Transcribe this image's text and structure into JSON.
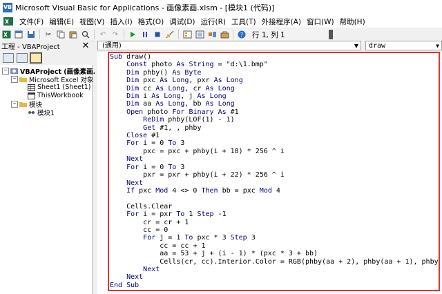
{
  "window": {
    "title": "Microsoft Visual Basic for Applications - 画像素画.xlsm - [模块1 (代码)]"
  },
  "menu": [
    "文件(F)",
    "编辑(E)",
    "视图(V)",
    "插入(I)",
    "格式(O)",
    "调试(D)",
    "运行(R)",
    "工具(T)",
    "外接程序(A)",
    "窗口(W)",
    "帮助(H)"
  ],
  "toolbar": {
    "position_text": "行 1, 列 1"
  },
  "project_panel": {
    "title": "工程 - VBAProject",
    "close": "✕",
    "tree": [
      {
        "toggle": "−",
        "label": "VBAProject (画像素画.",
        "icon": "vbaproject-icon",
        "bold": true
      },
      {
        "toggle": "−",
        "label": "Microsoft Excel 对象",
        "icon": "folder-icon"
      },
      {
        "toggle": "",
        "label": "Sheet1 (Sheet1)",
        "icon": "sheet-icon"
      },
      {
        "toggle": "",
        "label": "ThisWorkbook",
        "icon": "workbook-icon"
      },
      {
        "toggle": "−",
        "label": "模块",
        "icon": "folder-icon"
      },
      {
        "toggle": "",
        "label": "模块1",
        "icon": "module-icon"
      }
    ]
  },
  "editor": {
    "object_combo": "(通用)",
    "procedure_combo": "draw",
    "code_lines": [
      "Sub draw()",
      "    Const photo As String = \"d:\\1.bmp\"",
      "    Dim phby() As Byte",
      "    Dim pxc As Long, pxr As Long",
      "    Dim cc As Long, cr As Long",
      "    Dim i As Long, j As Long",
      "    Dim aa As Long, bb As Long",
      "    Open photo For Binary As #1",
      "        ReDim phby(LOF(1) - 1)",
      "        Get #1, , phby",
      "    Close #1",
      "    For i = 0 To 3",
      "        pxc = pxc + phby(i + 18) * 256 ^ i",
      "    Next",
      "    For i = 0 To 3",
      "        pxr = pxr + phby(i + 22) * 256 ^ i",
      "    Next",
      "    If pxc Mod 4 <> 0 Then bb = pxc Mod 4",
      "",
      "    Cells.Clear",
      "    For i = pxr To 1 Step -1",
      "        cr = cr + 1",
      "        cc = 0",
      "        For j = 1 To pxc * 3 Step 3",
      "            cc = cc + 1",
      "            aa = 53 + j + (i - 1) * (pxc * 3 + bb)",
      "            Cells(cr, cc).Interior.Color = RGB(phby(aa + 2), phby(aa + 1), phby(aa))",
      "        Next",
      "    Next",
      "End Sub"
    ]
  },
  "colors": {
    "keyword": "#00007f",
    "highlight_border": "#e0332f"
  }
}
